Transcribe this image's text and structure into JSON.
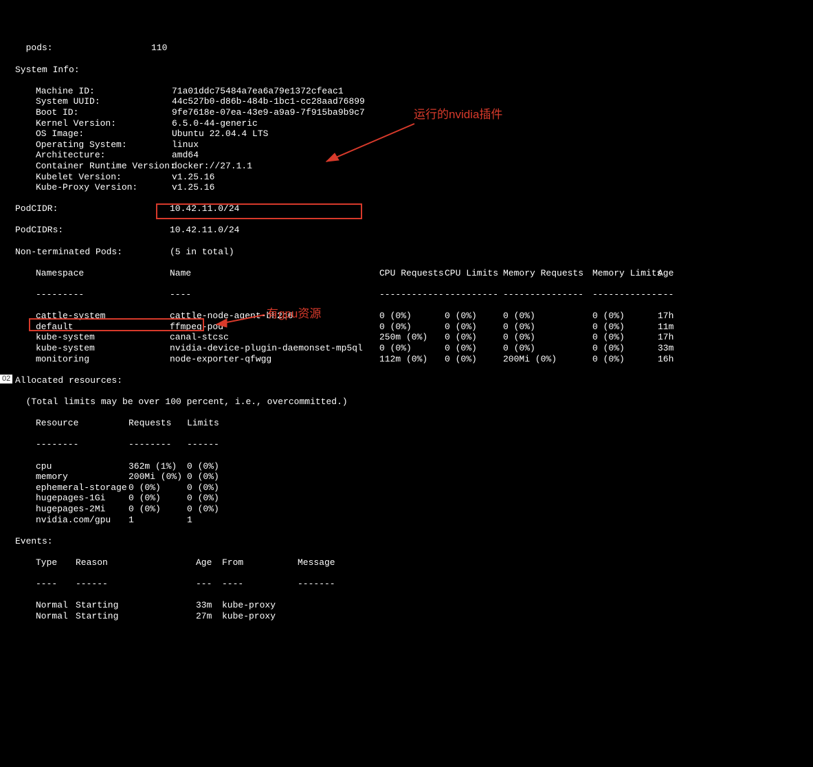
{
  "top_lines": [
    {
      "k": "  pods:",
      "v": "110"
    }
  ],
  "system_info_header": "System Info:",
  "system_info": [
    {
      "k": "Machine ID:",
      "v": "71a01ddc75484a7ea6a79e1372cfeac1"
    },
    {
      "k": "System UUID:",
      "v": "44c527b0-d86b-484b-1bc1-cc28aad76899"
    },
    {
      "k": "Boot ID:",
      "v": "9fe7618e-07ea-43e9-a9a9-7f915ba9b9c7"
    },
    {
      "k": "Kernel Version:",
      "v": "6.5.0-44-generic"
    },
    {
      "k": "OS Image:",
      "v": "Ubuntu 22.04.4 LTS"
    },
    {
      "k": "Operating System:",
      "v": "linux"
    },
    {
      "k": "Architecture:",
      "v": "amd64"
    },
    {
      "k": "Container Runtime Version:",
      "v": "docker://27.1.1"
    },
    {
      "k": "Kubelet Version:",
      "v": "v1.25.16"
    },
    {
      "k": "Kube-Proxy Version:",
      "v": "v1.25.16"
    }
  ],
  "podcidr": {
    "k": "PodCIDR:",
    "v": "10.42.11.0/24"
  },
  "podcidrs": {
    "k": "PodCIDRs:",
    "v": "10.42.11.0/24"
  },
  "nonterm_header": {
    "k": "Non-terminated Pods:",
    "v": "(5 in total)"
  },
  "pod_headers": {
    "ns": "Namespace",
    "name": "Name",
    "cpur": "CPU Requests",
    "cpul": "CPU Limits",
    "memr": "Memory Requests",
    "meml": "Memory Limits",
    "age": "Age"
  },
  "pod_dashes": {
    "ns": "---------",
    "name": "----",
    "cpur": "------------",
    "cpul": "----------",
    "memr": "---------------",
    "meml": "-------------",
    "age": "---"
  },
  "pods": [
    {
      "ns": "cattle-system",
      "name": "cattle-node-agent-bh2c6",
      "cpur": "0 (0%)",
      "cpul": "0 (0%)",
      "memr": "0 (0%)",
      "meml": "0 (0%)",
      "age": "17h"
    },
    {
      "ns": "default",
      "name": "ffmpeg-pod",
      "cpur": "0 (0%)",
      "cpul": "0 (0%)",
      "memr": "0 (0%)",
      "meml": "0 (0%)",
      "age": "11m"
    },
    {
      "ns": "kube-system",
      "name": "canal-stcsc",
      "cpur": "250m (0%)",
      "cpul": "0 (0%)",
      "memr": "0 (0%)",
      "meml": "0 (0%)",
      "age": "17h"
    },
    {
      "ns": "kube-system",
      "name": "nvidia-device-plugin-daemonset-mp5ql",
      "cpur": "0 (0%)",
      "cpul": "0 (0%)",
      "memr": "0 (0%)",
      "meml": "0 (0%)",
      "age": "33m"
    },
    {
      "ns": "monitoring",
      "name": "node-exporter-qfwgg",
      "cpur": "112m (0%)",
      "cpul": "0 (0%)",
      "memr": "200Mi (0%)",
      "meml": "0 (0%)",
      "age": "16h"
    }
  ],
  "alloc_header": "Allocated resources:",
  "alloc_note": "  (Total limits may be over 100 percent, i.e., overcommitted.)",
  "res_headers": {
    "c1": "Resource",
    "c2": "Requests",
    "c3": "Limits"
  },
  "res_dashes": {
    "c1": "--------",
    "c2": "--------",
    "c3": "------"
  },
  "resources": [
    {
      "c1": "cpu",
      "c2": "362m (1%)",
      "c3": "0 (0%)"
    },
    {
      "c1": "memory",
      "c2": "200Mi (0%)",
      "c3": "0 (0%)"
    },
    {
      "c1": "ephemeral-storage",
      "c2": "0 (0%)",
      "c3": "0 (0%)"
    },
    {
      "c1": "hugepages-1Gi",
      "c2": "0 (0%)",
      "c3": "0 (0%)"
    },
    {
      "c1": "hugepages-2Mi",
      "c2": "0 (0%)",
      "c3": "0 (0%)"
    },
    {
      "c1": "nvidia.com/gpu",
      "c2": "1",
      "c3": "1"
    }
  ],
  "events_header": "Events:",
  "ev_headers": {
    "type": "Type",
    "reason": "Reason",
    "age": "Age",
    "from": "From",
    "msg": "Message"
  },
  "ev_dashes": {
    "type": "----",
    "reason": "------",
    "age": "---",
    "from": "----",
    "msg": "-------"
  },
  "events": [
    {
      "type": "Normal",
      "reason": "Starting",
      "age": "33m",
      "from": "kube-proxy",
      "msg": ""
    },
    {
      "type": "Normal",
      "reason": "Starting",
      "age": "27m",
      "from": "kube-proxy",
      "msg": ""
    }
  ],
  "annotations": {
    "top": "运行的nvidia插件",
    "bottom": "有gpu资源"
  },
  "corner": "02"
}
